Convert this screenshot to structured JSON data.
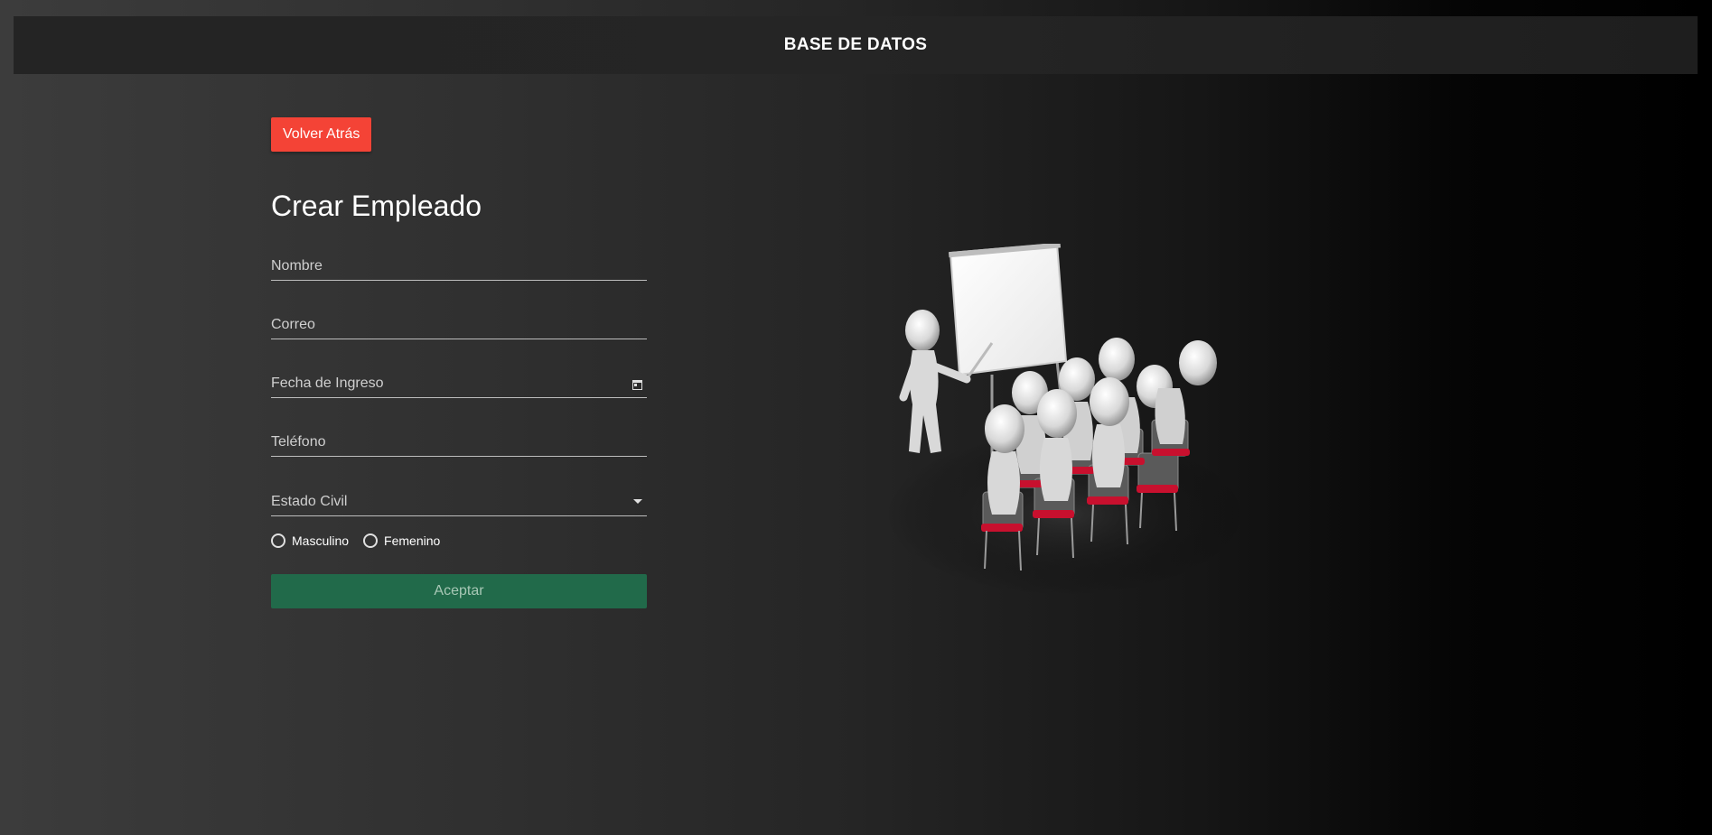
{
  "header": {
    "title": "BASE DE DATOS"
  },
  "back_button": {
    "label": "Volver Atrás",
    "color": "#f44336"
  },
  "form": {
    "title": "Crear Empleado",
    "fields": {
      "nombre": {
        "placeholder": "Nombre",
        "value": ""
      },
      "correo": {
        "placeholder": "Correo",
        "value": ""
      },
      "fecha_ingreso": {
        "label": "Fecha de Ingreso",
        "icon": "calendar-icon"
      },
      "telefono": {
        "placeholder": "Teléfono",
        "value": ""
      },
      "estado_civil": {
        "label": "Estado Civil",
        "icon": "chevron-down-icon"
      }
    },
    "gender": {
      "options": [
        "Masculino",
        "Femenino"
      ],
      "selected": null
    },
    "submit_label": "Aceptar",
    "submit_color": "#216a4a"
  },
  "illustration": {
    "subject": "presenter-with-audience-icon"
  }
}
